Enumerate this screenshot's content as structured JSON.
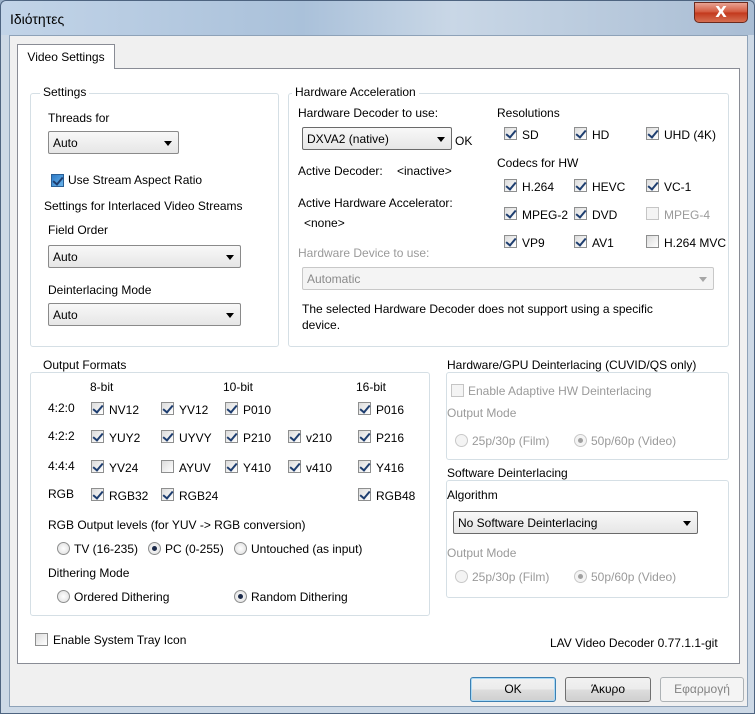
{
  "window": {
    "title": "Ιδιότητες",
    "close_glyph": "X"
  },
  "tab": {
    "label": "Video Settings"
  },
  "settings": {
    "group_label": "Settings",
    "threads_label": "Threads for",
    "threads_value": "Auto",
    "aspect_label": "Use Stream Aspect Ratio",
    "aspect_checked": true,
    "interlaced_label": "Settings for Interlaced Video Streams",
    "field_order_label": "Field Order",
    "field_order_value": "Auto",
    "deint_mode_label": "Deinterlacing Mode",
    "deint_mode_value": "Auto"
  },
  "hwaccel": {
    "group_label": "Hardware Acceleration",
    "decoder_label": "Hardware Decoder to use:",
    "decoder_value": "DXVA2 (native)",
    "decoder_status": "OK",
    "active_decoder_label": "Active Decoder:",
    "active_decoder_value": "<inactive>",
    "active_accel_label": "Active Hardware Accelerator:",
    "active_accel_value": "<none>",
    "device_label": "Hardware Device to use:",
    "device_value": "Automatic",
    "note_line1": "The selected Hardware Decoder does not support using a specific",
    "note_line2": "device.",
    "resolutions_label": "Resolutions",
    "resolutions": [
      {
        "label": "SD",
        "checked": true,
        "enabled": true
      },
      {
        "label": "HD",
        "checked": true,
        "enabled": true
      },
      {
        "label": "UHD (4K)",
        "checked": true,
        "enabled": true
      }
    ],
    "codecs_label": "Codecs for HW",
    "codecs": [
      {
        "label": "H.264",
        "checked": true,
        "enabled": true
      },
      {
        "label": "HEVC",
        "checked": true,
        "enabled": true
      },
      {
        "label": "VC-1",
        "checked": true,
        "enabled": true
      },
      {
        "label": "MPEG-2",
        "checked": true,
        "enabled": true
      },
      {
        "label": "DVD",
        "checked": true,
        "enabled": true
      },
      {
        "label": "MPEG-4",
        "checked": false,
        "enabled": false
      },
      {
        "label": "VP9",
        "checked": true,
        "enabled": true
      },
      {
        "label": "AV1",
        "checked": true,
        "enabled": true
      },
      {
        "label": "H.264 MVC",
        "checked": false,
        "enabled": true
      }
    ]
  },
  "output": {
    "group_label": "Output Formats",
    "col_8bit": "8-bit",
    "col_10bit": "10-bit",
    "col_16bit": "16-bit",
    "rows": [
      {
        "label": "4:2:0",
        "formats": [
          {
            "label": "NV12",
            "checked": true
          },
          {
            "label": "YV12",
            "checked": true
          },
          {
            "label": "P010",
            "checked": true
          },
          null,
          {
            "label": "P016",
            "checked": true
          }
        ]
      },
      {
        "label": "4:2:2",
        "formats": [
          {
            "label": "YUY2",
            "checked": true
          },
          {
            "label": "UYVY",
            "checked": true
          },
          {
            "label": "P210",
            "checked": true
          },
          {
            "label": "v210",
            "checked": true
          },
          {
            "label": "P216",
            "checked": true
          }
        ]
      },
      {
        "label": "4:4:4",
        "formats": [
          {
            "label": "YV24",
            "checked": true
          },
          {
            "label": "AYUV",
            "checked": false
          },
          {
            "label": "Y410",
            "checked": true
          },
          {
            "label": "v410",
            "checked": true
          },
          {
            "label": "Y416",
            "checked": true
          }
        ]
      },
      {
        "label": "RGB",
        "formats": [
          {
            "label": "RGB32",
            "checked": true
          },
          {
            "label": "RGB24",
            "checked": true
          },
          null,
          null,
          {
            "label": "RGB48",
            "checked": true
          }
        ]
      }
    ],
    "rgb_levels_label": "RGB Output levels (for YUV -> RGB conversion)",
    "rgb_levels": [
      {
        "label": "TV (16-235)",
        "selected": false
      },
      {
        "label": "PC (0-255)",
        "selected": true
      },
      {
        "label": "Untouched (as input)",
        "selected": false
      }
    ],
    "dithering_label": "Dithering Mode",
    "dithering": [
      {
        "label": "Ordered Dithering",
        "selected": false
      },
      {
        "label": "Random Dithering",
        "selected": true
      }
    ]
  },
  "hwdeint": {
    "group_label": "Hardware/GPU Deinterlacing (CUVID/QS only)",
    "adaptive_label": "Enable Adaptive HW Deinterlacing",
    "output_mode_label": "Output Mode",
    "mode_film": "25p/30p (Film)",
    "mode_video": "50p/60p (Video)"
  },
  "swdeint": {
    "group_label": "Software Deinterlacing",
    "algorithm_label": "Algorithm",
    "algorithm_value": "No Software Deinterlacing",
    "output_mode_label": "Output Mode",
    "mode_film": "25p/30p (Film)",
    "mode_video": "50p/60p (Video)"
  },
  "footer": {
    "tray_label": "Enable System Tray Icon",
    "version": "LAV Video Decoder 0.77.1.1-git"
  },
  "buttons": {
    "ok": "OK",
    "cancel": "Άκυρο",
    "apply": "Εφαρμογή"
  }
}
